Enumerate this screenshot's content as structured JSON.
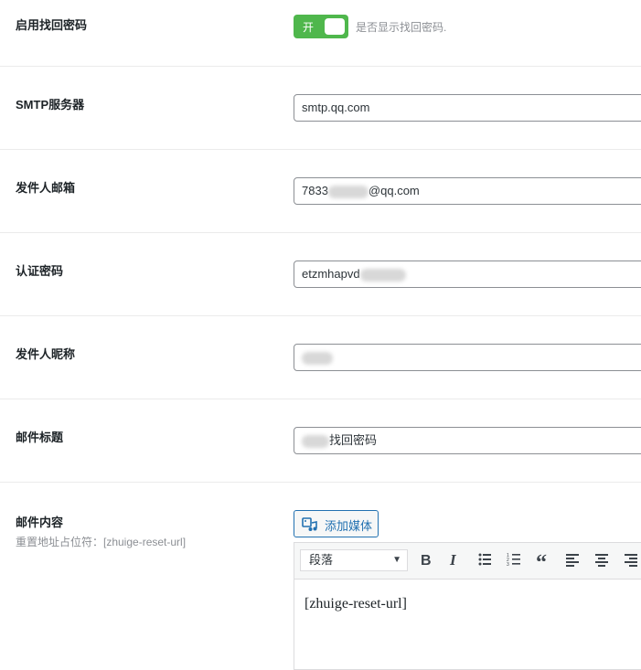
{
  "settings": {
    "enable_reset": {
      "label": "启用找回密码",
      "toggle_text": "开",
      "toggle_on": true,
      "description": "是否显示找回密码."
    },
    "smtp_server": {
      "label": "SMTP服务器",
      "value": "smtp.qq.com"
    },
    "sender_email": {
      "label": "发件人邮箱",
      "value_prefix": "7833",
      "value_suffix": "@qq.com"
    },
    "auth_password": {
      "label": "认证密码",
      "value_prefix": "etzmhapvd"
    },
    "sender_name": {
      "label": "发件人昵称"
    },
    "mail_subject": {
      "label": "邮件标题",
      "value_suffix": "找回密码"
    },
    "mail_content": {
      "label": "邮件内容",
      "description": "重置地址占位符：[zhuige-reset-url]",
      "add_media_label": "添加媒体",
      "format_selected": "段落",
      "body_text": "[zhuige-reset-url]"
    }
  },
  "colors": {
    "toggle_on": "#4fb74c",
    "accent": "#2271b1",
    "muted_text": "#8c8f94"
  },
  "toolbar_icons": [
    "bold-icon",
    "italic-icon",
    "bullet-list-icon",
    "numbered-list-icon",
    "blockquote-icon",
    "align-left-icon",
    "align-center-icon",
    "align-right-icon"
  ]
}
